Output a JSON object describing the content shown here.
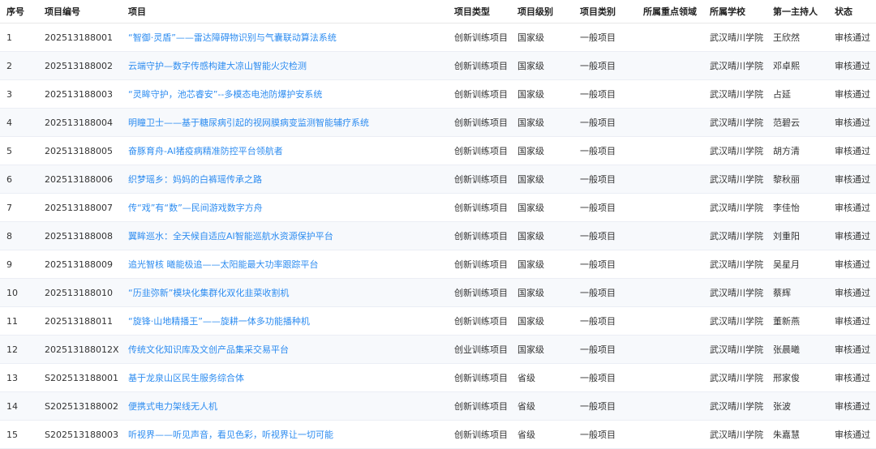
{
  "headers": {
    "seq": "序号",
    "code": "项目编号",
    "name": "项目",
    "type": "项目类型",
    "level": "项目级别",
    "category": "项目类别",
    "field": "所属重点领域",
    "school": "所属学校",
    "leader": "第一主持人",
    "status": "状态"
  },
  "rows": [
    {
      "seq": "1",
      "code": "202513188001",
      "name": "“智御·灵盾”——雷达障碍物识别与气囊联动算法系统",
      "type": "创新训练项目",
      "level": "国家级",
      "category": "一般项目",
      "field": "",
      "school": "武汉晴川学院",
      "leader": "王欣然",
      "status": "审核通过"
    },
    {
      "seq": "2",
      "code": "202513188002",
      "name": "云端守护—数字传感构建大凉山智能火灾检测",
      "type": "创新训练项目",
      "level": "国家级",
      "category": "一般项目",
      "field": "",
      "school": "武汉晴川学院",
      "leader": "邓卓熙",
      "status": "审核通过"
    },
    {
      "seq": "3",
      "code": "202513188003",
      "name": "“灵眸守护，池芯睿安”--多模态电池防爆护安系统",
      "type": "创新训练项目",
      "level": "国家级",
      "category": "一般项目",
      "field": "",
      "school": "武汉晴川学院",
      "leader": "占延",
      "status": "审核通过"
    },
    {
      "seq": "4",
      "code": "202513188004",
      "name": "明瞳卫士——基于糖尿病引起的视网膜病变监测智能辅疗系统",
      "type": "创新训练项目",
      "level": "国家级",
      "category": "一般项目",
      "field": "",
      "school": "武汉晴川学院",
      "leader": "范碧云",
      "status": "审核通过"
    },
    {
      "seq": "5",
      "code": "202513188005",
      "name": "奋豚育舟-AI猪疫病精准防控平台领航者",
      "type": "创新训练项目",
      "level": "国家级",
      "category": "一般项目",
      "field": "",
      "school": "武汉晴川学院",
      "leader": "胡方清",
      "status": "审核通过"
    },
    {
      "seq": "6",
      "code": "202513188006",
      "name": "织梦瑶乡：妈妈的白裤瑶传承之路",
      "type": "创新训练项目",
      "level": "国家级",
      "category": "一般项目",
      "field": "",
      "school": "武汉晴川学院",
      "leader": "黎秋丽",
      "status": "审核通过"
    },
    {
      "seq": "7",
      "code": "202513188007",
      "name": "传“戏”有“数”—民间游戏数字方舟",
      "type": "创新训练项目",
      "level": "国家级",
      "category": "一般项目",
      "field": "",
      "school": "武汉晴川学院",
      "leader": "李佳怡",
      "status": "审核通过"
    },
    {
      "seq": "8",
      "code": "202513188008",
      "name": "翼眸巡水：全天候自适应AI智能巡航水资源保护平台",
      "type": "创新训练项目",
      "level": "国家级",
      "category": "一般项目",
      "field": "",
      "school": "武汉晴川学院",
      "leader": "刘重阳",
      "status": "审核通过"
    },
    {
      "seq": "9",
      "code": "202513188009",
      "name": "追光智核 曦能极追——太阳能最大功率跟踪平台",
      "type": "创新训练项目",
      "level": "国家级",
      "category": "一般项目",
      "field": "",
      "school": "武汉晴川学院",
      "leader": "吴星月",
      "status": "审核通过"
    },
    {
      "seq": "10",
      "code": "202513188010",
      "name": "“历韭弥新”模块化集群化双化韭菜收割机",
      "type": "创新训练项目",
      "level": "国家级",
      "category": "一般项目",
      "field": "",
      "school": "武汉晴川学院",
      "leader": "蔡辉",
      "status": "审核通过"
    },
    {
      "seq": "11",
      "code": "202513188011",
      "name": "“旋锋·山地精播王”——旋耕一体多功能播种机",
      "type": "创新训练项目",
      "level": "国家级",
      "category": "一般项目",
      "field": "",
      "school": "武汉晴川学院",
      "leader": "董新燕",
      "status": "审核通过"
    },
    {
      "seq": "12",
      "code": "202513188012X",
      "name": "传统文化知识库及文创产品集采交易平台",
      "type": "创业训练项目",
      "level": "国家级",
      "category": "一般项目",
      "field": "",
      "school": "武汉晴川学院",
      "leader": "张晨曦",
      "status": "审核通过"
    },
    {
      "seq": "13",
      "code": "S202513188001",
      "name": "基于龙泉山区民生服务综合体",
      "type": "创新训练项目",
      "level": "省级",
      "category": "一般项目",
      "field": "",
      "school": "武汉晴川学院",
      "leader": "邢家俊",
      "status": "审核通过"
    },
    {
      "seq": "14",
      "code": "S202513188002",
      "name": "便携式电力架线无人机",
      "type": "创新训练项目",
      "level": "省级",
      "category": "一般项目",
      "field": "",
      "school": "武汉晴川学院",
      "leader": "张波",
      "status": "审核通过"
    },
    {
      "seq": "15",
      "code": "S202513188003",
      "name": "听视界——听见声音，看见色彩，听视界让一切可能",
      "type": "创新训练项目",
      "level": "省级",
      "category": "一般项目",
      "field": "",
      "school": "武汉晴川学院",
      "leader": "朱嘉慧",
      "status": "审核通过"
    }
  ]
}
